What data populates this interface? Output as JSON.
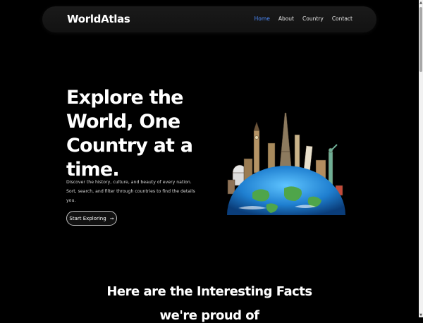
{
  "nav": {
    "brand": "WorldAtlas",
    "links": [
      {
        "label": "Home",
        "active": true
      },
      {
        "label": "About",
        "active": false
      },
      {
        "label": "Country",
        "active": false
      },
      {
        "label": "Contact",
        "active": false
      }
    ]
  },
  "hero": {
    "title": "Explore the World, One Country at a time.",
    "description": "Discover the history, culture, and beauty of every nation. Sort, search, and filter through countries to find the details you.",
    "button_label": "Start Exploring",
    "button_icon": "arrow-right-icon",
    "image": "world-landmarks-globe"
  },
  "facts": {
    "heading": "Here are the Interesting Facts",
    "subheading": "we're proud of"
  },
  "colors": {
    "background": "#000000",
    "accent": "#4d8cff",
    "text": "#ffffff"
  }
}
